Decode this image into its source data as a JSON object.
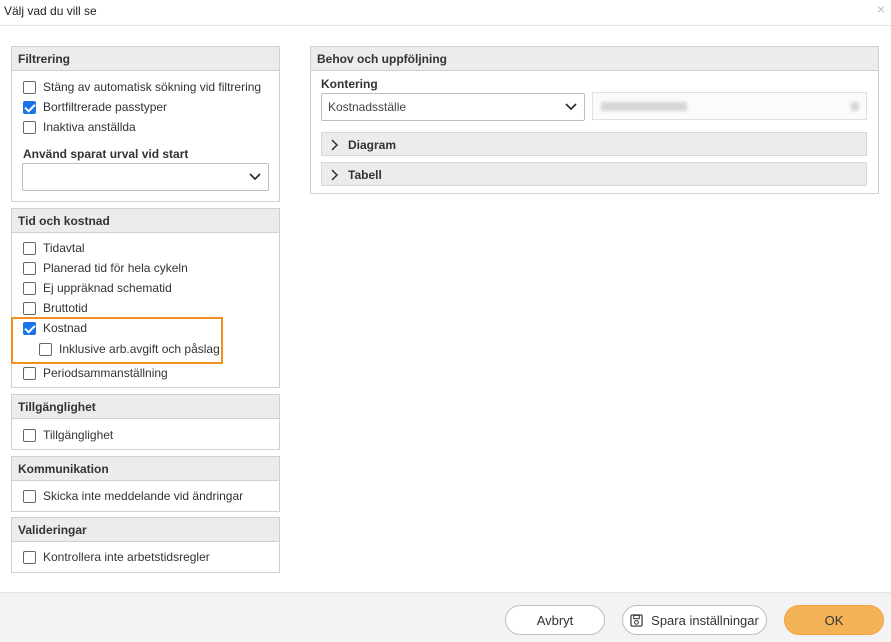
{
  "dialog": {
    "title": "Välj vad du vill se",
    "close_glyph": "×"
  },
  "filtrering": {
    "header": "Filtrering",
    "items": [
      {
        "label": "Stäng av automatisk sökning vid filtrering",
        "checked": false
      },
      {
        "label": "Bortfiltrerade passtyper",
        "checked": true
      },
      {
        "label": "Inaktiva anställda",
        "checked": false
      }
    ],
    "saved_selection_label": "Använd sparat urval vid start",
    "saved_selection_value": ""
  },
  "tid_och_kostnad": {
    "header": "Tid och kostnad",
    "items": [
      {
        "label": "Tidavtal",
        "checked": false
      },
      {
        "label": "Planerad tid för hela cykeln",
        "checked": false
      },
      {
        "label": "Ej uppräknad schematid",
        "checked": false
      },
      {
        "label": "Bruttotid",
        "checked": false
      },
      {
        "label": "Kostnad",
        "checked": true
      },
      {
        "label": "Inklusive arb.avgift och påslag",
        "checked": false
      },
      {
        "label": "Periodsammanställning",
        "checked": false
      }
    ]
  },
  "tillganglighet": {
    "header": "Tillgänglighet",
    "items": [
      {
        "label": "Tillgänglighet",
        "checked": false
      }
    ]
  },
  "kommunikation": {
    "header": "Kommunikation",
    "items": [
      {
        "label": "Skicka inte meddelande vid ändringar",
        "checked": false
      }
    ]
  },
  "valideringar": {
    "header": "Valideringar",
    "items": [
      {
        "label": "Kontrollera inte arbetstidsregler",
        "checked": false
      }
    ]
  },
  "behov": {
    "header": "Behov och uppföljning",
    "kontering_label": "Kontering",
    "kontering_value": "Kostnadsställe",
    "accordions": [
      {
        "label": "Diagram"
      },
      {
        "label": "Tabell"
      }
    ]
  },
  "footer": {
    "cancel_label": "Avbryt",
    "save_label": "Spara inställningar",
    "ok_label": "OK"
  },
  "colors": {
    "accent": "#1a73e8",
    "highlight": "#f0901e",
    "ok_button": "#f4b256"
  }
}
